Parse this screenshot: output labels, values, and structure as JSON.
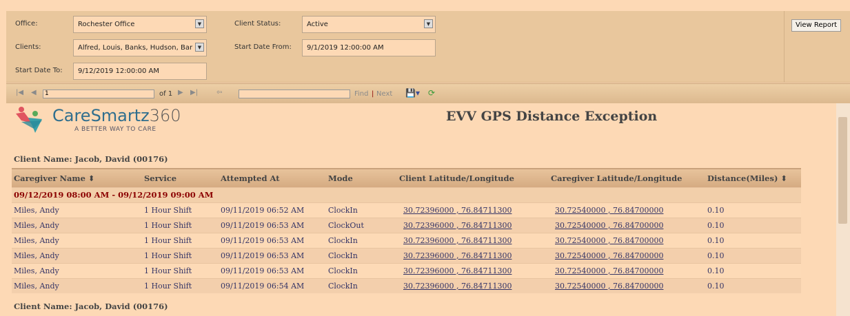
{
  "params": {
    "office_label": "Office:",
    "office_value": "Rochester Office",
    "status_label": "Client Status:",
    "status_value": "Active",
    "clients_label": "Clients:",
    "clients_value": "Alfred, Louis, Banks, Hudson, Bar",
    "from_label": "Start Date From:",
    "from_value": "9/1/2019 12:00:00 AM",
    "to_label": "Start Date To:",
    "to_value": "9/12/2019 12:00:00 AM",
    "view_report": "View Report"
  },
  "toolbar": {
    "page": "1",
    "of": "of 1",
    "find": "Find",
    "sep": "|",
    "next": "Next",
    "search": ""
  },
  "report": {
    "logo_text": "CareSmartz",
    "logo_num": "360",
    "tagline": "A BETTER WAY TO CARE",
    "title": "EVV GPS Distance Exception",
    "client1": "Client Name: Jacob, David (00176)",
    "client2": "Client Name: Jacob, David (00176)",
    "columns": [
      "Caregiver Name",
      "Service",
      "Attempted At",
      "Mode",
      "Client Latitude/Longitude",
      "Caregiver Latitude/Longitude",
      "Distance(Miles)"
    ],
    "group": "09/12/2019 08:00 AM - 09/12/2019 09:00 AM",
    "rows": [
      [
        "Miles, Andy",
        "1 Hour Shift",
        "09/11/2019 06:52 AM",
        "ClockIn",
        "30.72396000 , 76.84711300",
        "30.72540000 , 76.84700000",
        "0.10"
      ],
      [
        "Miles, Andy",
        "1 Hour Shift",
        "09/11/2019 06:53 AM",
        "ClockOut",
        "30.72396000 , 76.84711300",
        "30.72540000 , 76.84700000",
        "0.10"
      ],
      [
        "Miles, Andy",
        "1 Hour Shift",
        "09/11/2019 06:53 AM",
        "ClockIn",
        "30.72396000 , 76.84711300",
        "30.72540000 , 76.84700000",
        "0.10"
      ],
      [
        "Miles, Andy",
        "1 Hour Shift",
        "09/11/2019 06:53 AM",
        "ClockIn",
        "30.72396000 , 76.84711300",
        "30.72540000 , 76.84700000",
        "0.10"
      ],
      [
        "Miles, Andy",
        "1 Hour Shift",
        "09/11/2019 06:53 AM",
        "ClockIn",
        "30.72396000 , 76.84711300",
        "30.72540000 , 76.84700000",
        "0.10"
      ],
      [
        "Miles, Andy",
        "1 Hour Shift",
        "09/11/2019 06:54 AM",
        "ClockIn",
        "30.72396000 , 76.84711300",
        "30.72540000 , 76.84700000",
        "0.10"
      ]
    ]
  }
}
